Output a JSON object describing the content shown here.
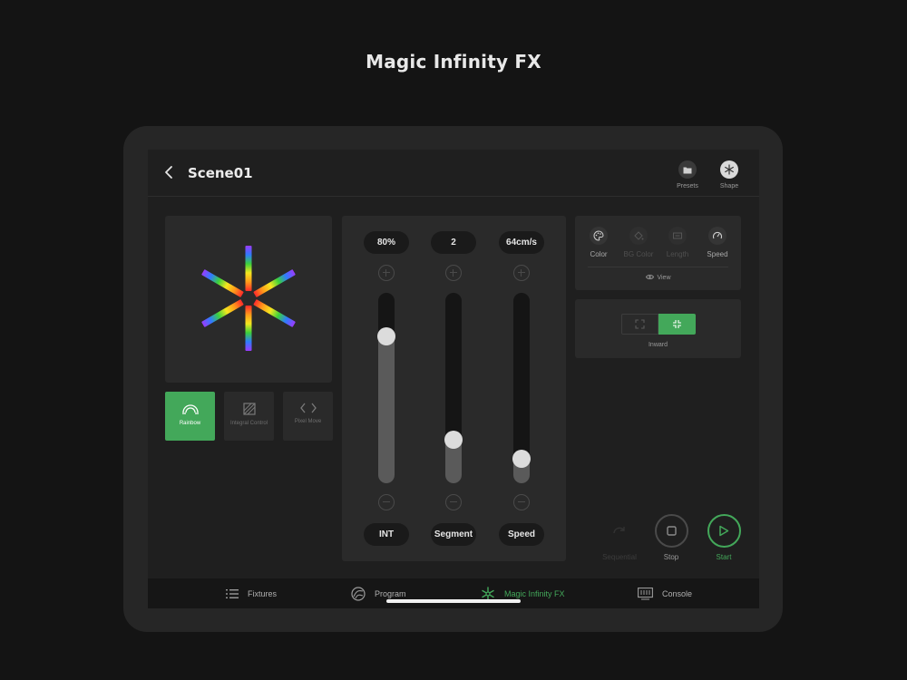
{
  "page_title": "Magic Infinity FX",
  "header": {
    "scene_title": "Scene01",
    "buttons": [
      {
        "label": "Presets",
        "icon": "folder-icon"
      },
      {
        "label": "Shape",
        "icon": "snowflake-icon",
        "active": true
      }
    ]
  },
  "modes": [
    {
      "label": "Rainbow",
      "icon": "rainbow-icon",
      "active": true
    },
    {
      "label": "Integral Control",
      "icon": "hatch-square-icon",
      "active": false
    },
    {
      "label": "Pixel Move",
      "icon": "code-arrows-icon",
      "active": false
    }
  ],
  "sliders": [
    {
      "name": "INT",
      "value": "80%",
      "level": 0.77
    },
    {
      "name": "Segment",
      "value": "2",
      "level": 0.23
    },
    {
      "name": "Speed",
      "value": "64cm/s",
      "level": 0.13
    }
  ],
  "properties": [
    {
      "label": "Color",
      "icon": "palette-icon",
      "enabled": true
    },
    {
      "label": "BG Color",
      "icon": "paint-bucket-icon",
      "enabled": false
    },
    {
      "label": "Length",
      "icon": "length-icon",
      "enabled": false
    },
    {
      "label": "Speed",
      "icon": "speedometer-icon",
      "enabled": true
    }
  ],
  "view_label": "View",
  "direction": {
    "label": "Inward",
    "selected": "inward"
  },
  "transport": [
    {
      "label": "Sequential",
      "icon": "sequential-icon",
      "enabled": false
    },
    {
      "label": "Stop",
      "icon": "stop-icon",
      "enabled": true
    },
    {
      "label": "Start",
      "icon": "play-icon",
      "enabled": true,
      "accent": "#43a85a"
    }
  ],
  "nav": [
    {
      "label": "Fixtures",
      "icon": "list-icon"
    },
    {
      "label": "Program",
      "icon": "program-icon"
    },
    {
      "label": "Magic Infinity FX",
      "icon": "snowflake-icon",
      "active": true
    },
    {
      "label": "Console",
      "icon": "console-icon"
    }
  ],
  "colors": {
    "accent": "#43a85a",
    "background": "#141414",
    "panel": "#2a2a2a"
  }
}
